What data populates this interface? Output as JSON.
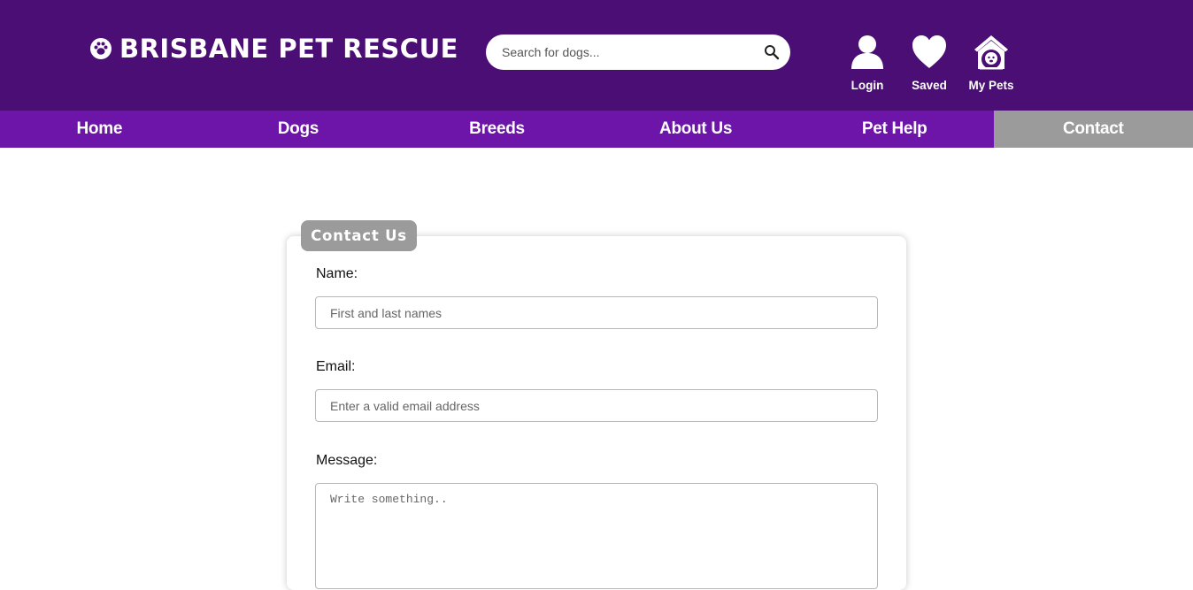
{
  "site": {
    "title": "BRISBANE PET RESCUE",
    "paw_icon": "paw-icon"
  },
  "search": {
    "placeholder": "Search for dogs...",
    "icon": "search-icon"
  },
  "header_actions": [
    {
      "label": "Login",
      "icon": "user-icon"
    },
    {
      "label": "Saved",
      "icon": "heart-icon"
    },
    {
      "label": "My Pets",
      "icon": "doghouse-icon"
    }
  ],
  "nav": {
    "items": [
      "Home",
      "Dogs",
      "Breeds",
      "About Us",
      "Pet Help",
      "Contact"
    ],
    "active": "Contact"
  },
  "form": {
    "heading": "Contact Us",
    "name_label": "Name:",
    "name_placeholder": "First and last names",
    "email_label": "Email:",
    "email_placeholder": "Enter a valid email address",
    "message_label": "Message:",
    "message_placeholder": "Write something.."
  },
  "colors": {
    "header_bg": "#4a0e75",
    "nav_bg": "#6c15a8",
    "active_tab": "#9b9b9b"
  }
}
